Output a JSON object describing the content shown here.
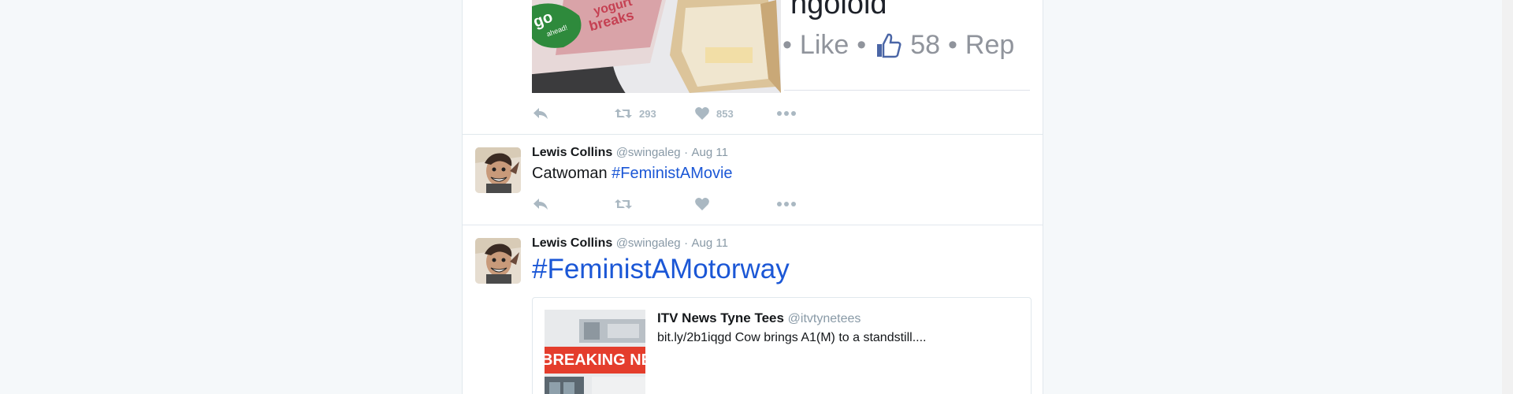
{
  "timeline": {
    "tweets": [
      {
        "media": {
          "screenshot_title": "ngoloid",
          "screenshot_like_label": "Like",
          "screenshot_like_count": "58",
          "screenshot_reply_label": "Rep",
          "yogurt_text_1": "go",
          "yogurt_text_2": "ahead!",
          "yogurt_text_3": "yogurt",
          "yogurt_text_4": "breaks"
        },
        "retweet_count": "293",
        "like_count": "853"
      },
      {
        "name": "Lewis Collins",
        "handle": "@swingaleg",
        "dot": "·",
        "time": "Aug 11",
        "text": "Catwoman",
        "hashtag": "#FeministAMovie"
      },
      {
        "name": "Lewis Collins",
        "handle": "@swingaleg",
        "dot": "·",
        "time": "Aug 11",
        "hashtag": "#FeministAMotorway",
        "quote": {
          "name": "ITV News Tyne Tees",
          "handle": "@itvtynetees",
          "text": "bit.ly/2b1iqgd Cow brings A1(M) to a standstill....",
          "image_banner": "BREAKING NEWS"
        }
      }
    ]
  },
  "icons": {
    "reply": "reply-icon",
    "retweet": "retweet-icon",
    "like": "heart-icon",
    "more": "more-icon"
  },
  "colors": {
    "link": "#1b57d6",
    "muted": "#8899a6",
    "icon": "#aab8c2",
    "breaking": "#e43d2c"
  }
}
